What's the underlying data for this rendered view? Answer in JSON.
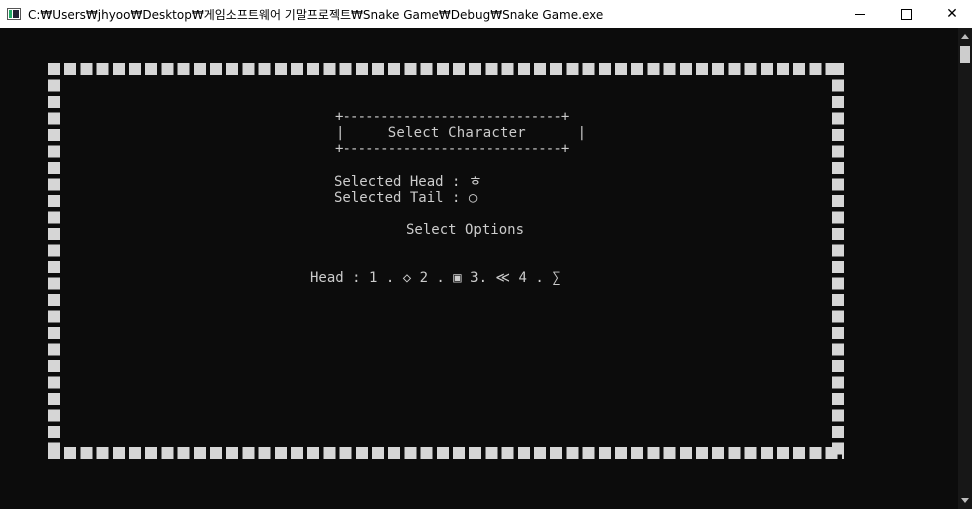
{
  "window": {
    "title": "C:₩Users₩jhyoo₩Desktop₩게임소프트웨어 기말프로젝트₩Snake Game₩Debug₩Snake Game.exe",
    "minimize_glyph": "minimize",
    "maximize_glyph": "maximize",
    "close_glyph": "✕"
  },
  "game": {
    "box_top": "+-----------------------------+",
    "box_middle": "|     Select Character      |",
    "box_bottom": "+-----------------------------+",
    "selected_head_line": "Selected Head : ㅎ",
    "selected_tail_line": "Selected Tail : ○",
    "select_options": "Select Options",
    "head_options_line": "Head : 1 . ◇ 2 . ▣ 3. ≪ 4 . ∑"
  }
}
